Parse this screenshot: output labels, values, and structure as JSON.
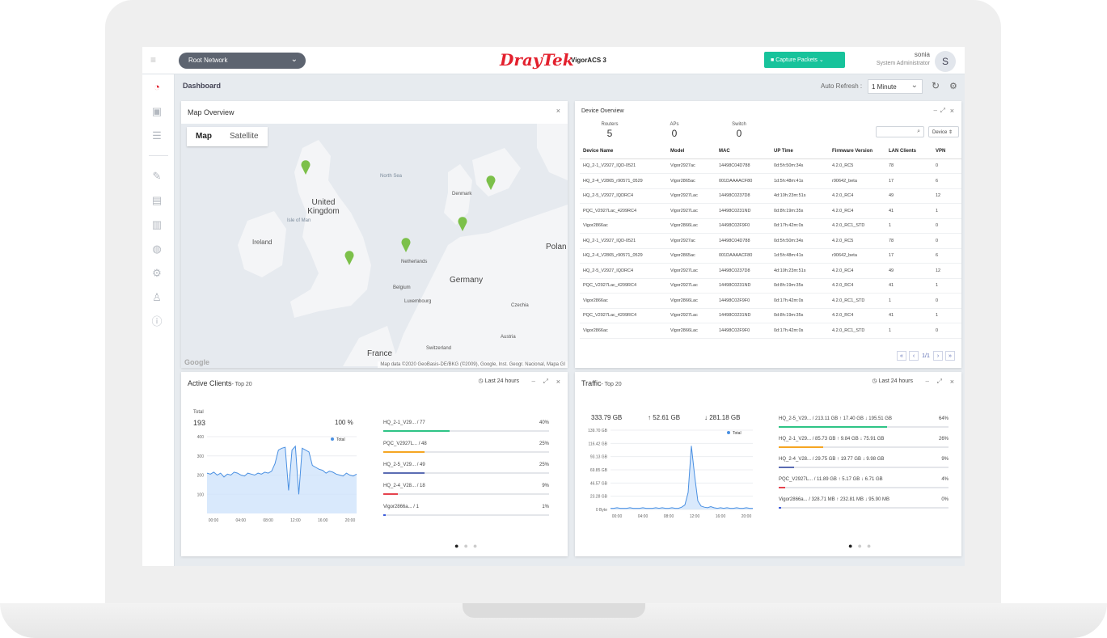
{
  "header": {
    "network_selector": "Root Network",
    "brand": "DrayTek",
    "product": "VigorACS 3",
    "capture_button": "Capture Packets",
    "user_name": "sonia",
    "user_role": "System Administrator",
    "avatar_initial": "S"
  },
  "page": {
    "breadcrumb": "Dashboard",
    "auto_refresh_label": "Auto Refresh :",
    "auto_refresh_value": "1 Minute"
  },
  "map_panel": {
    "title": "Map Overview",
    "tab_map": "Map",
    "tab_satellite": "Satellite",
    "credit": "Map data ©2020 GeoBasis-DE/BKG (©2009), Google, Inst. Geogr. Nacional, Mapa GI",
    "google": "Google",
    "labels": {
      "north_sea": "North Sea",
      "uk": "United Kingdom",
      "isle_of_man": "Isle of Man",
      "ireland": "Ireland",
      "denmark": "Denmark",
      "netherlands": "Netherlands",
      "germany": "Germany",
      "belgium": "Belgium",
      "luxembourg": "Luxembourg",
      "poland": "Polan",
      "czechia": "Czechia",
      "austria": "Austria",
      "switzerland": "Switzerland",
      "france": "France"
    }
  },
  "device_panel": {
    "title": "Device Overview",
    "counts": [
      {
        "label": "Routers",
        "value": "5"
      },
      {
        "label": "APs",
        "value": "0"
      },
      {
        "label": "Switch",
        "value": "0"
      }
    ],
    "filter": "Device",
    "columns": [
      "Device Name",
      "Model",
      "MAC",
      "UP Time",
      "Firmware Version",
      "LAN Clients",
      "VPN"
    ],
    "rows": [
      [
        "HQ_2-1_V2927_IQD-0521",
        "Vigor2927ac",
        "14498C04D788",
        "0d:5h:50m:34s",
        "4.2.0_RC5",
        "78",
        "0"
      ],
      [
        "HQ_2-4_V2865_r90571_0529",
        "Vigor2865ac",
        "001DAAAACF80",
        "1d:5h:48m:41s",
        "r90642_beta",
        "17",
        "6"
      ],
      [
        "HQ_2-5_V2927_IQDRC4",
        "Vigor2927Lac",
        "14498C0237D8",
        "4d:10h:23m:51s",
        "4.2.0_RC4",
        "49",
        "12"
      ],
      [
        "PQC_V2927Lac_4209RC4",
        "Vigor2927Lac",
        "14498C0231ND",
        "0d:8h:19m:35s",
        "4.2.0_RC4",
        "41",
        "1"
      ],
      [
        "Vigor2866ac",
        "Vigor2866Lac",
        "14498C02F9F0",
        "0d:17h:42m:0s",
        "4.2.0_RC1_STD",
        "1",
        "0"
      ],
      [
        "HQ_2-1_V2927_IQD-0521",
        "Vigor2927ac",
        "14498C04D788",
        "0d:5h:50m:34s",
        "4.2.0_RC5",
        "78",
        "0"
      ],
      [
        "HQ_2-4_V2865_r90571_0529",
        "Vigor2865ac",
        "001DAAAACF80",
        "1d:5h:48m:41s",
        "r90642_beta",
        "17",
        "6"
      ],
      [
        "HQ_2-5_V2927_IQDRC4",
        "Vigor2927Lac",
        "14498C0237D8",
        "4d:10h:23m:51s",
        "4.2.0_RC4",
        "49",
        "12"
      ],
      [
        "PQC_V2927Lac_4209RC4",
        "Vigor2927Lac",
        "14498C0231ND",
        "0d:8h:19m:35s",
        "4.2.0_RC4",
        "41",
        "1"
      ],
      [
        "Vigor2866ac",
        "Vigor2866Lac",
        "14498C02F9F0",
        "0d:17h:42m:0s",
        "4.2.0_RC1_STD",
        "1",
        "0"
      ],
      [
        "PQC_V2927Lac_4209RC4",
        "Vigor2927Lac",
        "14498C0231ND",
        "0d:8h:19m:35s",
        "4.2.0_RC4",
        "41",
        "1"
      ],
      [
        "Vigor2866ac",
        "Vigor2866Lac",
        "14498C02F9F0",
        "0d:17h:42m:0s",
        "4.2.0_RC1_STD",
        "1",
        "0"
      ]
    ],
    "pager": [
      "«",
      "‹",
      "1/1",
      "›",
      "»"
    ]
  },
  "clients_panel": {
    "title": "Active Clients",
    "subtitle": "- Top 20",
    "range": "Last 24 hours",
    "total_label": "Total",
    "total_value": "193",
    "total_pct": "100 %",
    "legend": "Total",
    "bars": [
      {
        "label": "HQ_2-1_V29... / 77",
        "pct": "40%",
        "fraction": 0.4,
        "color": "#2ec486"
      },
      {
        "label": "PQC_V2927L... / 48",
        "pct": "25%",
        "fraction": 0.25,
        "color": "#f5a623"
      },
      {
        "label": "HQ_2-5_V29... / 49",
        "pct": "25%",
        "fraction": 0.25,
        "color": "#5b6cb3"
      },
      {
        "label": "HQ_2-4_V28... / 18",
        "pct": "9%",
        "fraction": 0.09,
        "color": "#e5424d"
      },
      {
        "label": "Vigor2866a... / 1",
        "pct": "1%",
        "fraction": 0.01,
        "color": "#3b5bdb"
      }
    ]
  },
  "traffic_panel": {
    "title": "Traffic",
    "subtitle": "- Top 20",
    "range": "Last 24 hours",
    "stat_total": "333.79 GB",
    "stat_up": "↑ 52.61 GB",
    "stat_down": "↓ 281.18 GB",
    "legend": "Total",
    "bars": [
      {
        "label": "HQ_2-5_V29... / 213.11 GB ↑ 17.40 GB ↓ 195.51 GB",
        "pct": "64%",
        "fraction": 0.64,
        "color": "#2ec486"
      },
      {
        "label": "HQ_2-1_V29... / 85.73 GB ↑ 9.84 GB ↓ 75.91 GB",
        "pct": "26%",
        "fraction": 0.26,
        "color": "#f5a623"
      },
      {
        "label": "HQ_2-4_V28... / 29.75 GB ↑ 19.77 GB ↓ 9.98 GB",
        "pct": "9%",
        "fraction": 0.09,
        "color": "#5b6cb3"
      },
      {
        "label": "PQC_V2927L... / 11.89 GB ↑ 5.17 GB ↓ 6.71 GB",
        "pct": "4%",
        "fraction": 0.04,
        "color": "#e5424d"
      },
      {
        "label": "Vigor2866a... / 328.71 MB ↑ 232.81 MB ↓ 95.90 MB",
        "pct": "0%",
        "fraction": 0.005,
        "color": "#3b5bdb"
      }
    ]
  },
  "chart_data": [
    {
      "type": "area",
      "title": "Active Clients",
      "x_ticks": [
        "00:00",
        "04:00",
        "08:00",
        "12:00",
        "16:00",
        "20:00"
      ],
      "y_ticks": [
        "400",
        "300",
        "200",
        "100"
      ],
      "ylim": [
        0,
        400
      ],
      "series": [
        {
          "name": "Total",
          "values": [
            210,
            205,
            215,
            200,
            210,
            190,
            205,
            200,
            215,
            210,
            200,
            195,
            210,
            205,
            200,
            210,
            205,
            215,
            210,
            220,
            260,
            330,
            340,
            345,
            120,
            330,
            350,
            100,
            340,
            330,
            320,
            250,
            240,
            230,
            225,
            210,
            220,
            215,
            205,
            200,
            195,
            210,
            200,
            195,
            205
          ]
        }
      ]
    },
    {
      "type": "area",
      "title": "Traffic",
      "x_ticks": [
        "00:00",
        "04:00",
        "08:00",
        "12:00",
        "16:00",
        "20:00"
      ],
      "y_ticks": [
        "139.70 GB",
        "116.42 GB",
        "93.13 GB",
        "69.85 GB",
        "46.57 GB",
        "23.28 GB",
        "0 Byte"
      ],
      "ylim": [
        0,
        139.7
      ],
      "series": [
        {
          "name": "Total",
          "values": [
            2,
            2,
            3,
            2,
            2,
            2,
            3,
            2,
            2,
            2,
            3,
            2,
            2,
            2,
            3,
            2,
            3,
            2,
            2,
            3,
            2,
            2,
            4,
            8,
            30,
            112,
            60,
            15,
            6,
            4,
            3,
            5,
            3,
            2,
            3,
            2,
            3,
            2,
            2,
            3,
            2,
            2,
            3,
            2,
            2
          ]
        }
      ]
    }
  ]
}
